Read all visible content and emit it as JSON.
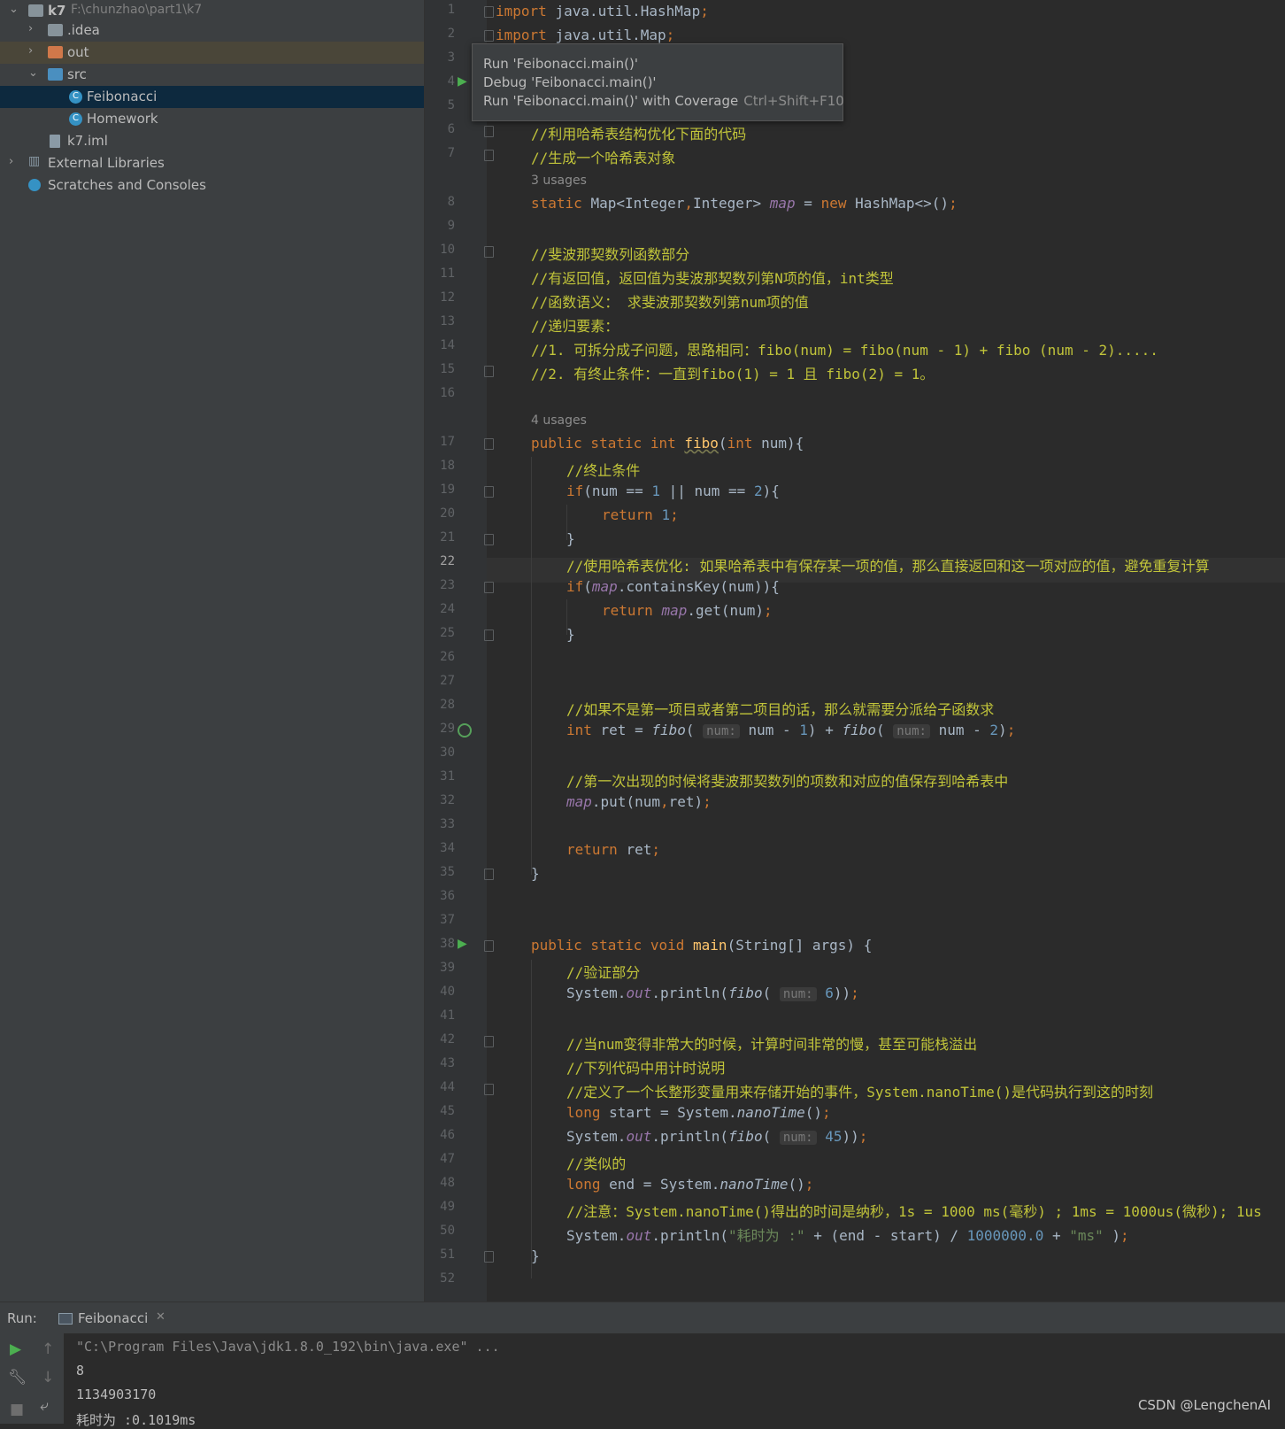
{
  "project_tree": {
    "root": {
      "name": "k7",
      "path": "F:\\chunzhao\\part1\\k7"
    },
    "items": [
      {
        "label": ".idea"
      },
      {
        "label": "out"
      },
      {
        "label": "src"
      },
      {
        "label": "Feibonacci"
      },
      {
        "label": "Homework"
      },
      {
        "label": "k7.iml"
      },
      {
        "label": "External Libraries"
      },
      {
        "label": "Scratches and Consoles"
      }
    ]
  },
  "popup": {
    "items": [
      {
        "label": "Run 'Feibonacci.main()'",
        "shortcut": ""
      },
      {
        "label": "Debug 'Feibonacci.main()'",
        "shortcut": ""
      },
      {
        "label": "Run 'Feibonacci.main()' with Coverage",
        "shortcut": "Ctrl+Shift+F10"
      }
    ]
  },
  "editor": {
    "current_line": 22,
    "usages": [
      "3 usages",
      "4 usages"
    ],
    "hint_label": "num:",
    "lines": [
      "import java.util.HashMap;",
      "import java.util.Map;",
      "//利用哈希表结构优化下面的代码",
      "//生成一个哈希表对象",
      "static Map<Integer,Integer> map = new HashMap<>();",
      "//斐波那契数列函数部分",
      "//有返回值，返回值为斐波那契数列第N项的值，int类型",
      "//函数语义： 求斐波那契数列第num项的值",
      "//递归要素：",
      "//1. 可拆分成子问题，思路相同：fibo(num) = fibo(num - 1) + fibo (num - 2).....",
      "//2. 有终止条件：一直到fibo(1) = 1 且 fibo(2) = 1。",
      "public static int fibo(int num){",
      "//终止条件",
      "if(num == 1 || num == 2){",
      "return 1;",
      "}",
      "//使用哈希表优化: 如果哈希表中有保存某一项的值，那么直接返回和这一项对应的值，避免重复计算",
      "if(map.containsKey(num)){",
      "return map.get(num);",
      "}",
      "//如果不是第一项目或者第二项目的话，那么就需要分派给子函数求",
      "int ret = fibo( num - 1) + fibo( num - 2);",
      "//第一次出现的时候将斐波那契数列的项数和对应的值保存到哈希表中",
      "map.put(num,ret);",
      "return ret;",
      "}",
      "public static void main(String[] args) {",
      "//验证部分",
      "System.out.println(fibo( 6));",
      "//当num变得非常大的时候，计算时间非常的慢，甚至可能栈溢出",
      "//下列代码中用计时说明",
      "//定义了一个长整形变量用来存储开始的事件，System.nanoTime()是代码执行到这的时刻",
      "long start = System.nanoTime();",
      "System.out.println(fibo( 45));",
      "//类似的",
      "long end = System.nanoTime();",
      "//注意：System.nanoTime()得出的时间是纳秒，1s = 1000 ms(毫秒) ; 1ms = 1000us(微秒); 1us",
      "System.out.println(\"耗时为 :\" + (end - start) / 1000000.0 + \"ms\" );",
      "}"
    ]
  },
  "run_panel": {
    "label": "Run:",
    "tab": "Feibonacci",
    "output": [
      "\"C:\\Program Files\\Java\\jdk1.8.0_192\\bin\\java.exe\" ...",
      "8",
      "1134903170",
      "耗时为 :0.1019ms"
    ]
  },
  "watermark": "CSDN @LengchenAI",
  "colors": {
    "keyword": "#cc7832",
    "comment": "#c1c43a",
    "number": "#6897bb",
    "string": "#6a8759",
    "method_decl": "#ffc66d",
    "static_field": "#9876aa",
    "selection": "#0d293e"
  }
}
